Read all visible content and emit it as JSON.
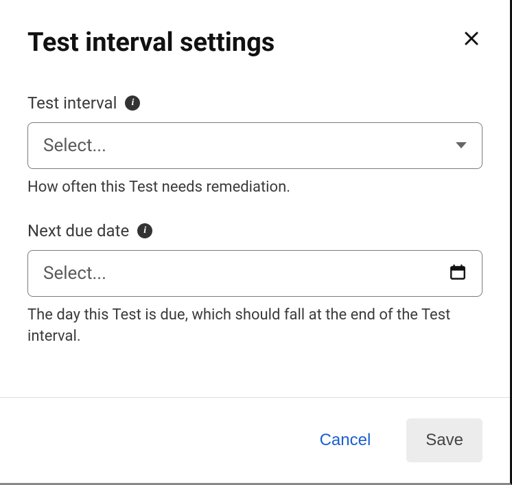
{
  "dialog": {
    "title": "Test interval settings",
    "close_aria": "Close"
  },
  "fields": {
    "interval": {
      "label": "Test interval",
      "placeholder": "Select...",
      "helper": "How often this Test needs remediation."
    },
    "due_date": {
      "label": "Next due date",
      "placeholder": "Select...",
      "helper": "The day this Test is due, which should fall at the end of the Test interval."
    }
  },
  "footer": {
    "cancel": "Cancel",
    "save": "Save"
  }
}
